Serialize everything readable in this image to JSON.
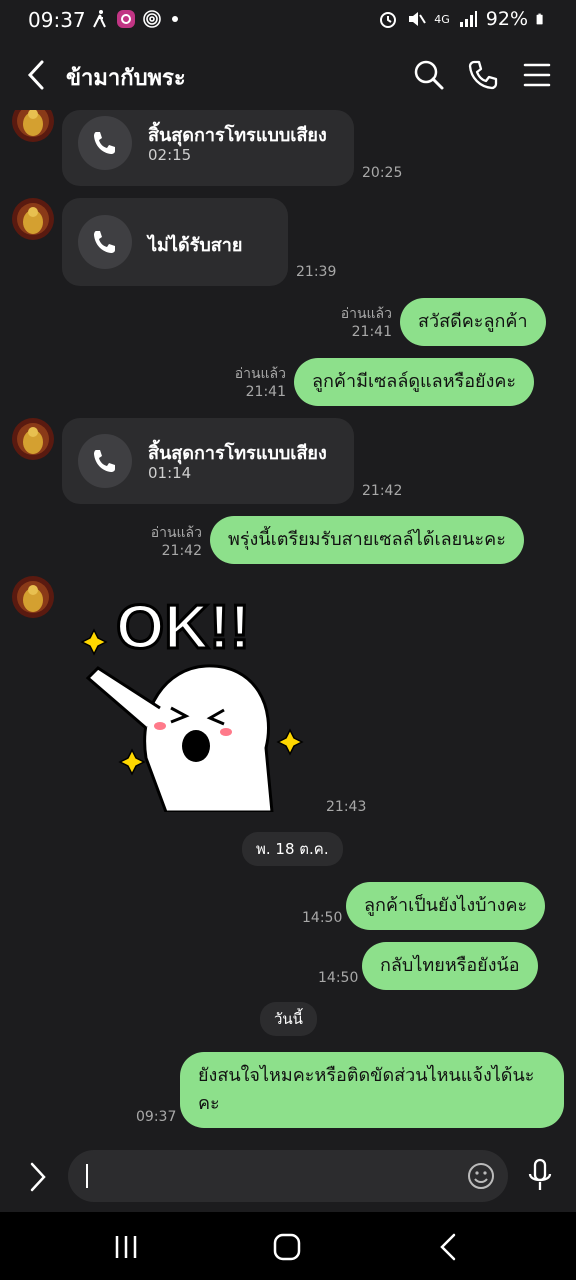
{
  "status_bar": {
    "time": "09:37",
    "battery": "92%",
    "network": "4G"
  },
  "header": {
    "title": "ข้ามากับพระ",
    "icons": [
      "back-arrow-icon",
      "search-icon",
      "phone-icon",
      "menu-icon"
    ]
  },
  "messages": [
    {
      "type": "call",
      "direction": "in",
      "title": "สิ้นสุดการโทรแบบเสียง",
      "duration": "02:15",
      "time": "20:25"
    },
    {
      "type": "call",
      "direction": "in",
      "title": "ไม่ได้รับสาย",
      "time": "21:39"
    },
    {
      "type": "text",
      "direction": "out",
      "read": "อ่านแล้ว",
      "time": "21:41",
      "text": "สวัสดีคะลูกค้า"
    },
    {
      "type": "text",
      "direction": "out",
      "read": "อ่านแล้ว",
      "time": "21:41",
      "text": "ลูกค้ามีเซลล์ดูแลหรือยังคะ"
    },
    {
      "type": "call",
      "direction": "in",
      "title": "สิ้นสุดการโทรแบบเสียง",
      "duration": "01:14",
      "time": "21:42"
    },
    {
      "type": "text",
      "direction": "out",
      "read": "อ่านแล้ว",
      "time": "21:42",
      "text": "พรุ่งนี้เตรียมรับสายเซลล์ได้เลยนะคะ"
    },
    {
      "type": "sticker",
      "direction": "in",
      "time": "21:43",
      "sticker_text": "OK!!"
    },
    {
      "type": "date",
      "label": "พ. 18 ต.ค."
    },
    {
      "type": "text",
      "direction": "out",
      "time": "14:50",
      "text": "ลูกค้าเป็นยังไงบ้างคะ"
    },
    {
      "type": "text",
      "direction": "out",
      "time": "14:50",
      "text": "กลับไทยหรือยังน้อ"
    },
    {
      "type": "date",
      "label": "วันนี้"
    },
    {
      "type": "text",
      "direction": "out",
      "time": "09:37",
      "text": "ยังสนใจไหมคะหรือติดขัดส่วนไหนแจ้งได้นะคะ"
    }
  ],
  "input": {
    "placeholder": ""
  },
  "colors": {
    "background": "#1c1c1e",
    "bubble_out": "#8de08b",
    "bubble_in": "#2c2c2e"
  }
}
